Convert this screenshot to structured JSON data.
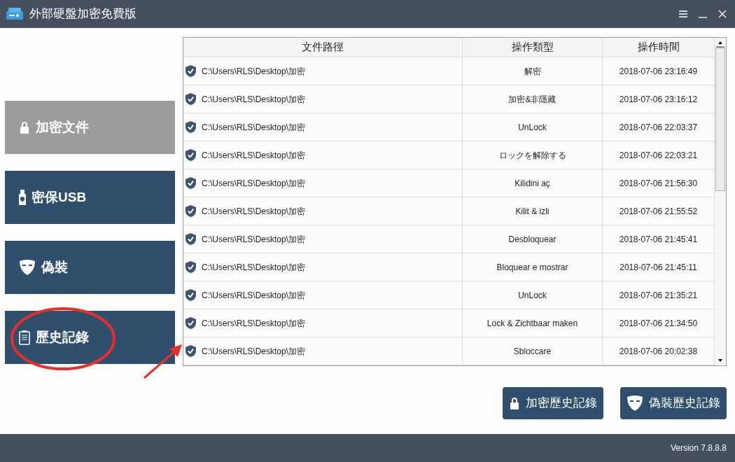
{
  "window": {
    "title": "外部硬盤加密免費版"
  },
  "sidebar": {
    "items": [
      {
        "label": "加密文件",
        "selected": true
      },
      {
        "label": "密保USB",
        "selected": false
      },
      {
        "label": "偽裝",
        "selected": false
      },
      {
        "label": "歷史記錄",
        "selected": false
      }
    ]
  },
  "table": {
    "columns": [
      "文件路徑",
      "操作類型",
      "操作時間"
    ],
    "rows": [
      {
        "path": "C:\\Users\\RLS\\Desktop\\加密",
        "type": "解密",
        "time": "2018-07-06 23:16:49"
      },
      {
        "path": "C:\\Users\\RLS\\Desktop\\加密",
        "type": "加密&非隱藏",
        "time": "2018-07-06 23:16:12"
      },
      {
        "path": "C:\\Users\\RLS\\Desktop\\加密",
        "type": "UnLock",
        "time": "2018-07-06 22:03:37"
      },
      {
        "path": "C:\\Users\\RLS\\Desktop\\加密",
        "type": "ロックを解除する",
        "time": "2018-07-06 22:03:21"
      },
      {
        "path": "C:\\Users\\RLS\\Desktop\\加密",
        "type": "Kilidini aç",
        "time": "2018-07-06 21:56:30"
      },
      {
        "path": "C:\\Users\\RLS\\Desktop\\加密",
        "type": "Kilit & izli",
        "time": "2018-07-06 21:55:52"
      },
      {
        "path": "C:\\Users\\RLS\\Desktop\\加密",
        "type": "Desbloquear",
        "time": "2018-07-06 21:45:41"
      },
      {
        "path": "C:\\Users\\RLS\\Desktop\\加密",
        "type": "Bloquear e mostrar",
        "time": "2018-07-06 21:45:11"
      },
      {
        "path": "C:\\Users\\RLS\\Desktop\\加密",
        "type": "UnLock",
        "time": "2018-07-06 21:35:21"
      },
      {
        "path": "C:\\Users\\RLS\\Desktop\\加密",
        "type": "Lock & Zichtbaar maken",
        "time": "2018-07-06 21:34:50"
      },
      {
        "path": "C:\\Users\\RLS\\Desktop\\加密",
        "type": "Sbloccare",
        "time": "2018-07-06 20:02:38"
      }
    ]
  },
  "buttons": [
    {
      "label": "加密歷史記錄"
    },
    {
      "label": "偽裝歷史記錄"
    }
  ],
  "status_bar": {
    "version": "Version 7.8.8.8"
  }
}
